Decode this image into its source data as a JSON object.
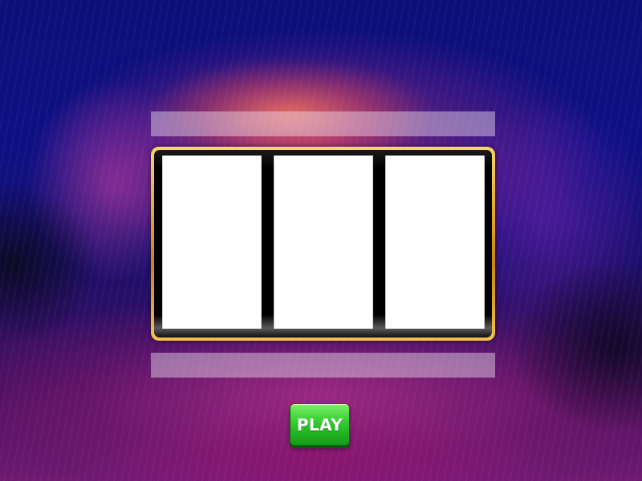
{
  "game": {
    "reels": [
      {
        "id": "reel-1",
        "symbol": ""
      },
      {
        "id": "reel-2",
        "symbol": ""
      },
      {
        "id": "reel-3",
        "symbol": ""
      }
    ],
    "play_label": "PLAY",
    "top_banner_text": "",
    "bottom_banner_text": ""
  },
  "colors": {
    "background_blue": "#0a0f6e",
    "frame_gold": "#e0a126",
    "play_green": "#2cc22d",
    "reel_white": "#ffffff"
  }
}
